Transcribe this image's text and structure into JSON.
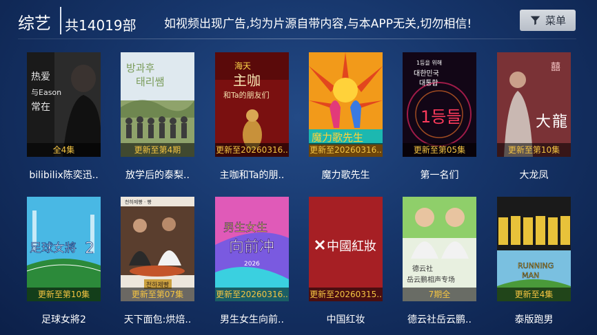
{
  "header": {
    "category": "综艺",
    "count": "共14019部",
    "notice": "如视频出现广告,均为片源自带内容,与本APP无关,切勿相信!",
    "menu_label": "菜单"
  },
  "items": [
    {
      "title": "bilibilix陈奕迅..",
      "badge": "全4集",
      "poster_text": "热爱与Eason常在",
      "icon": "poster-bilibili-eason"
    },
    {
      "title": "放学后的泰梨..",
      "badge": "更新至第4期",
      "poster_text": "방과후 태리쌤",
      "icon": "poster-school-group"
    },
    {
      "title": "主咖和Ta的朋..",
      "badge": "更新至20260316..",
      "poster_text": "主咖 和Ta的朋友们",
      "icon": "poster-host-friends"
    },
    {
      "title": "魔力歌先生",
      "badge": "更新至20260316..",
      "poster_text": "魔力歌先生",
      "icon": "poster-magic-singer"
    },
    {
      "title": "第一名们",
      "badge": "更新至第05集",
      "poster_text": "1등들",
      "icon": "poster-first-place"
    },
    {
      "title": "大龙凤",
      "badge": "更新至第10集",
      "poster_text": "大龍鳳",
      "icon": "poster-dragon-phoenix"
    },
    {
      "title": "足球女將2",
      "badge": "更新至第10集",
      "poster_text": "足球女將2",
      "icon": "poster-football-women"
    },
    {
      "title": "天下面包:烘焙..",
      "badge": "更新至第07集",
      "poster_text": "천하제빵",
      "icon": "poster-bakery"
    },
    {
      "title": "男生女生向前..",
      "badge": "更新至20260316..",
      "poster_text": "男生女生向前冲",
      "icon": "poster-boys-girls"
    },
    {
      "title": "中国红妆",
      "badge": "更新至20260315..",
      "poster_text": "中國紅妝",
      "icon": "poster-chinese-red"
    },
    {
      "title": "德云社岳云鹏..",
      "badge": "7期全",
      "poster_text": "岳云鹏相声专场",
      "icon": "poster-deyun-crosstalk"
    },
    {
      "title": "泰版跑男",
      "badge": "更新至4集",
      "poster_text": "RUNNING MAN",
      "icon": "poster-running-man"
    }
  ],
  "colors": {
    "badge_text": "#f5c542",
    "background": "#16356a"
  }
}
